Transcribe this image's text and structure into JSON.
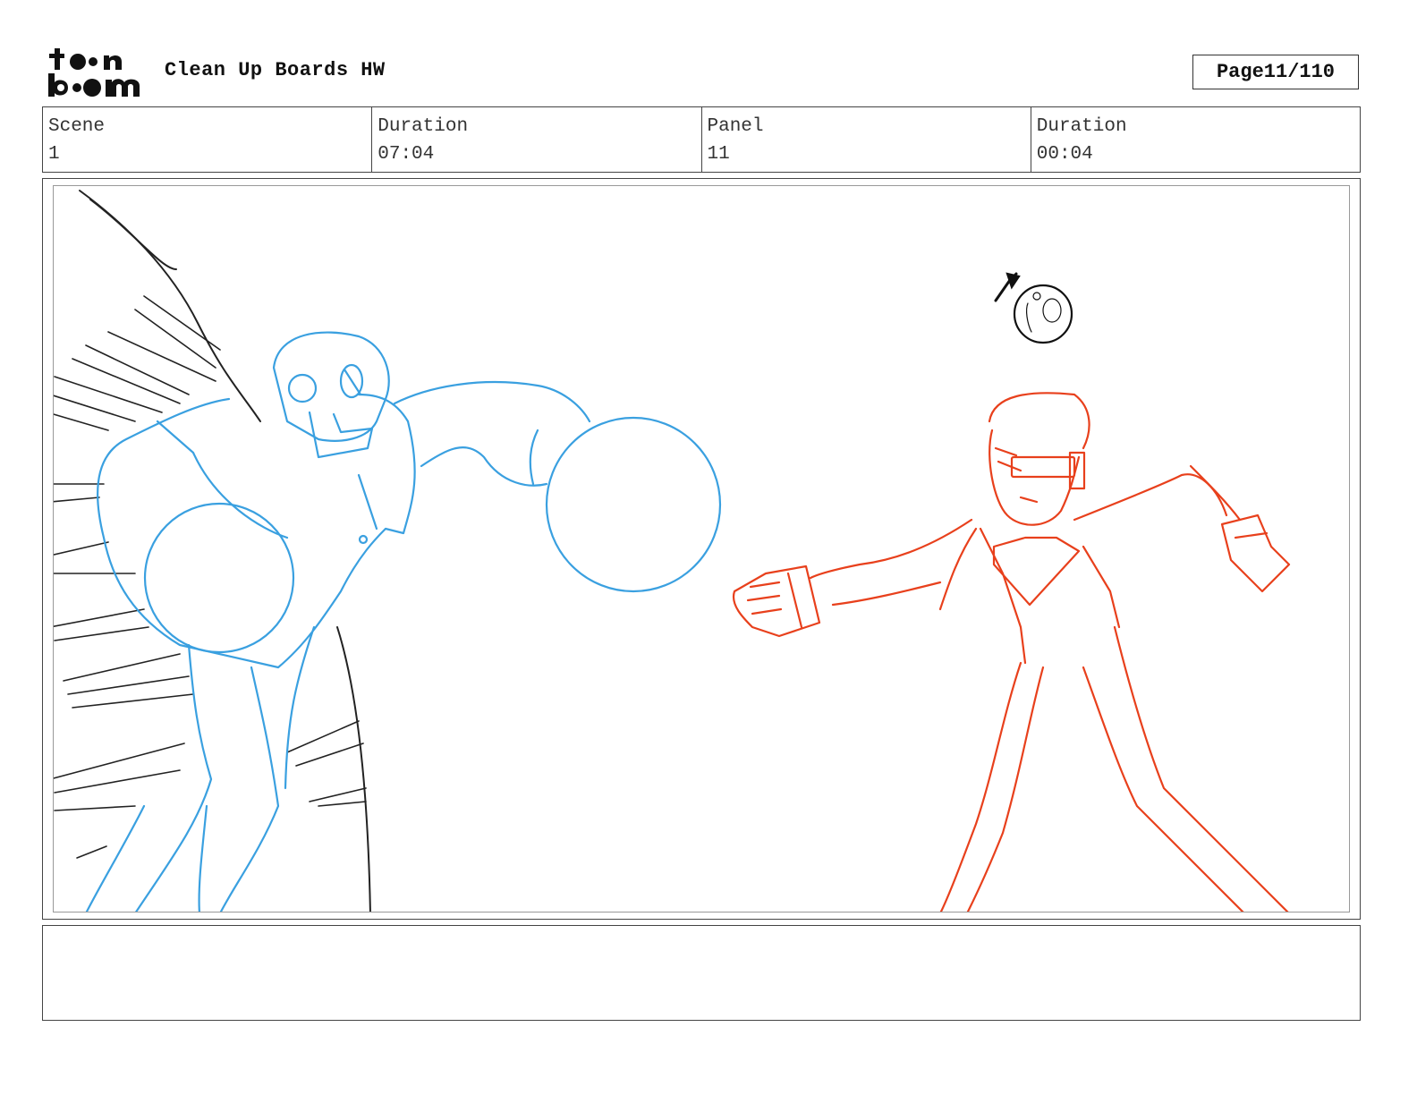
{
  "header": {
    "logo_text_top": "toon",
    "logo_text_bottom": "boom",
    "project_title": "Clean Up Boards HW",
    "page_label": "Page",
    "page_value": "11/110"
  },
  "info": {
    "scene_label": "Scene",
    "scene_value": "1",
    "scene_duration_label": "Duration",
    "scene_duration_value": "07:04",
    "panel_label": "Panel",
    "panel_value": "11",
    "panel_duration_label": "Duration",
    "panel_duration_value": "00:04"
  },
  "panel": {
    "robot_color": "#3aa0e0",
    "hero_color": "#e8401c",
    "background_color": "#222222"
  },
  "notes": {
    "text": ""
  }
}
